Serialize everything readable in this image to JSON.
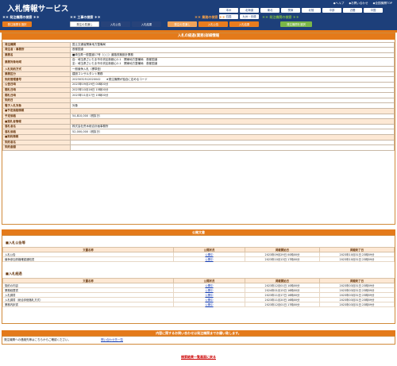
{
  "header": {
    "title": "入札情報サービス",
    "toplinks": [
      "◆ヘルプ",
      "◆お問い合わせ",
      "◆全国機関TOP"
    ],
    "regions": [
      "本州",
      "北海道",
      "東北",
      "関東",
      "北陸",
      "中部",
      "近畿",
      "中国",
      "四国",
      "九州・沖縄"
    ],
    "categories": [
      {
        "label": "＊＊ 工事の検索 ＊＊",
        "color": "#ffffff"
      },
      {
        "label": "＊＊ 業務の検索 ＊＊",
        "color": "#f4a04a"
      },
      {
        "label": "＊＊ 発注機関の検索 ＊＊",
        "color": "#7ab648"
      }
    ],
    "left_category": "＊＊ 発注機関の検索 ＊＊",
    "tabs": [
      {
        "label": "発注機関を選択",
        "style": "orange"
      },
      {
        "label": "発注の見通し",
        "style": ""
      },
      {
        "label": "入札公告",
        "style": "dark"
      },
      {
        "label": "入札結果",
        "style": "dark"
      },
      {
        "label": "入札結果",
        "style": "dark"
      },
      {
        "label": "発注の見通し",
        "style": "lightorange"
      },
      {
        "label": "入札公告",
        "style": "orange"
      },
      {
        "label": "入札結果",
        "style": "orange"
      },
      {
        "label": "発注機関を選択",
        "style": "green"
      }
    ]
  },
  "detail": {
    "section_title": "入札の経過(業務)詳細情報",
    "rows": [
      {
        "k": "発注機関",
        "v": "国土交通省関東地方整備局"
      },
      {
        "k": "発注者・事務所",
        "v": "首都国道"
      },
      {
        "k": "業務名",
        "v": "■埼玉県一般国道17号（○○）道路改築設計業務"
      },
      {
        "k": "業務対象地域",
        "v": "自：埼玉県さいたま市中央区新都心2-1　関東地方整備局　首都国道\n至：埼玉県さいたま市中央区新都心2-1　関東地方整備局　首都国道",
        "tall": true
      },
      {
        "k": "入札契約方式",
        "v": "一般競争入札（標準型）"
      },
      {
        "k": "業務区分",
        "v": "建設コンサルタント業務"
      },
      {
        "k": "契約管理番号",
        "v": "2023032512020042　　★発注機関が独自に定めるコード"
      },
      {
        "k": "公告日時",
        "v": "2023年09月29日 00時00分"
      },
      {
        "k": "開札日時",
        "v": "2023年10月16日 15時00分"
      },
      {
        "k": "開札日時",
        "v": "2023年11月17日 15時00分"
      },
      {
        "k": "契約日",
        "v": ""
      },
      {
        "k": "電子入札対象",
        "v": "対象"
      },
      {
        "k": "■予定価格情報",
        "v": "",
        "sub": true
      },
      {
        "k": "予定価格",
        "v": "54,810,000（税抜き）"
      },
      {
        "k": "■落札者情報",
        "v": "",
        "sub": true
      },
      {
        "k": "落札者名",
        "v": "株式会社荒木総合計画事務所"
      },
      {
        "k": "落札価格",
        "v": "52,000,000（税抜き）"
      },
      {
        "k": "■契約情報",
        "v": "",
        "sub": true
      },
      {
        "k": "契約者名",
        "v": ""
      },
      {
        "k": "契約金額",
        "v": ""
      }
    ]
  },
  "docs": {
    "section_title": "公開文書",
    "group1": "■入札公告等",
    "group2": "■入札経過",
    "headers": [
      "文書名称",
      "公開状況",
      "掲載開始日",
      "掲載終了日"
    ],
    "group1_rows": [
      {
        "name": "入札公告",
        "status": "公開中",
        "start": "2023年09月29日 00時00分",
        "end": "2023年10月31日 23時59分"
      },
      {
        "name": "競争参加資格確認通知書",
        "status": "公開中",
        "start": "2023年10月13日 17時00分",
        "end": "2023年10月31日 23時59分"
      }
    ],
    "group2_rows": [
      {
        "name": "契約の内容",
        "status": "公開中",
        "start": "2023年12月01日 10時00分",
        "end": "2023年03月31日 23時59分"
      },
      {
        "name": "業務経歴書",
        "status": "公開中",
        "start": "2024年01月15日 16時00分",
        "end": "2023年03月31日 23時59分"
      },
      {
        "name": "入札調書",
        "status": "公開中",
        "start": "2023年11月17日 16時00分",
        "end": "2023年03月31日 23時59分"
      },
      {
        "name": "入札調書（総合評価落札方式）",
        "status": "公開中",
        "start": "2023年11月20日 16時00分",
        "end": "2023年03月31日 23時59分"
      },
      {
        "name": "業務内訳書",
        "status": "公開中",
        "start": "2023年12月01日 17時00分",
        "end": "2023年03月31日 23時59分"
      }
    ]
  },
  "inquiry": {
    "banner": "内容に関するお問い合わせは発注機関までお願い致します。",
    "text": "発注機関への連絡先等はこちらからご確認ください。",
    "link": "問い合わせ先一覧"
  },
  "back_link": "検索結果一覧画面に戻る"
}
